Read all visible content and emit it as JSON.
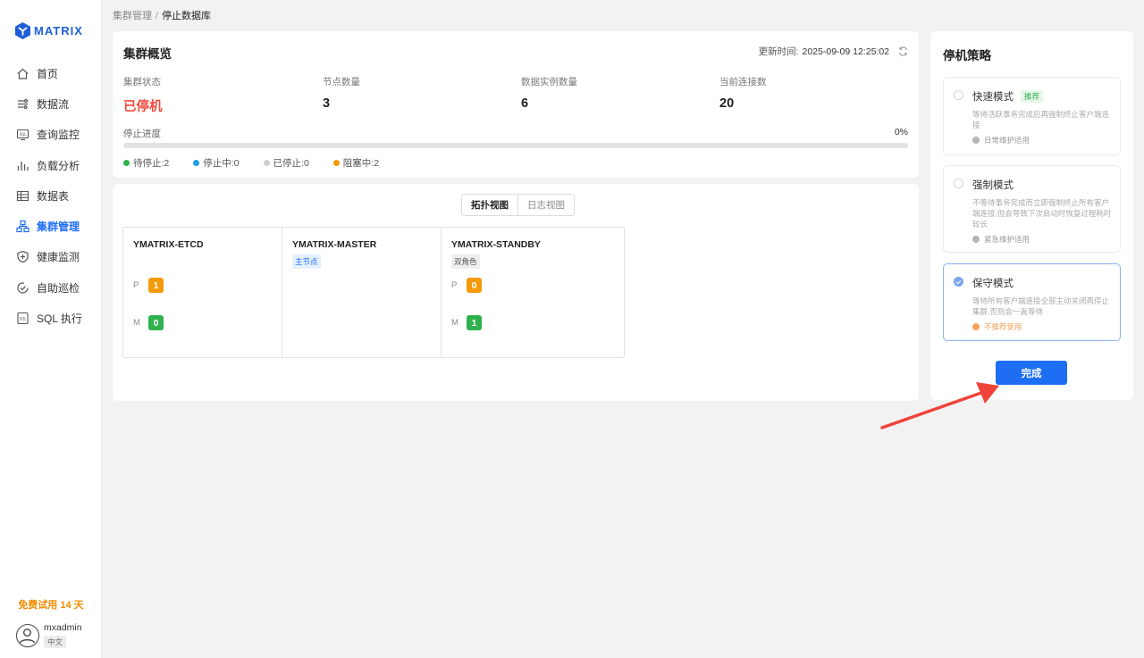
{
  "brand": {
    "name": "MATRIX",
    "color": "#1e5fd8"
  },
  "nav": {
    "items": [
      {
        "label": "首页",
        "icon": "home-icon"
      },
      {
        "label": "数据流",
        "icon": "dataflow-icon"
      },
      {
        "label": "查询监控",
        "icon": "sql-monitor-icon"
      },
      {
        "label": "负载分析",
        "icon": "bar-chart-icon"
      },
      {
        "label": "数据表",
        "icon": "table-icon"
      },
      {
        "label": "集群管理",
        "icon": "cluster-icon",
        "active": true
      },
      {
        "label": "健康监测",
        "icon": "shield-icon"
      },
      {
        "label": "自助巡检",
        "icon": "check-circle-icon"
      },
      {
        "label": "SQL 执行",
        "icon": "sql-file-icon"
      }
    ]
  },
  "trial": "免费试用 14 天",
  "user": {
    "name": "mxadmin",
    "lang": "中文"
  },
  "breadcrumb": {
    "parent": "集群管理",
    "separator": "/",
    "current": "停止数据库"
  },
  "overview": {
    "title": "集群概览",
    "update_label": "更新时间:",
    "update_time": "2025-09-09 12:25:02",
    "stats": [
      {
        "label": "集群状态",
        "value": "已停机"
      },
      {
        "label": "节点数量",
        "value": "3"
      },
      {
        "label": "数据实例数量",
        "value": "6"
      },
      {
        "label": "当前连接数",
        "value": "20"
      }
    ],
    "progress": {
      "label": "停止进度",
      "percent_text": "0%",
      "value": 0
    },
    "legend": [
      {
        "label": "待停止:2",
        "color": "#2fb24d"
      },
      {
        "label": "停止中:0",
        "color": "#1aa0e8"
      },
      {
        "label": "已停止:0",
        "color": "#cfcfcf"
      },
      {
        "label": "阻塞中:2",
        "color": "#f59a0a"
      }
    ]
  },
  "topology": {
    "views": [
      "拓扑视图",
      "日志视图"
    ],
    "nodes": [
      {
        "name": "YMATRIX-ETCD",
        "tag": "",
        "p": "1",
        "m": "0"
      },
      {
        "name": "YMATRIX-MASTER",
        "tag": "主节点"
      },
      {
        "name": "YMATRIX-STANDBY",
        "tag": "双角色",
        "p": "0",
        "m": "1"
      }
    ],
    "p_label": "P",
    "m_label": "M"
  },
  "strategy": {
    "title": "停机策略",
    "options": [
      {
        "title": "快速模式",
        "tag": "推荐",
        "desc": "等待活跃事务完成后再强制终止客户端连接",
        "note": "日常维护适用"
      },
      {
        "title": "强制模式",
        "desc": "不等待事务完成而立即强制终止所有客户端连接,但会导致下次启动时恢复过程耗时较长",
        "note": "紧急维护适用"
      },
      {
        "title": "保守模式",
        "desc": "等待所有客户端连接全部主动关闭再停止集群,否则会一直等待",
        "note": "不推荐使用",
        "selected": true
      }
    ],
    "done_label": "完成"
  },
  "colors": {
    "accent": "#1e6ef4",
    "stopped": "#f04a3e",
    "warning": "#f5a25c",
    "arrow": "#f0433a"
  }
}
